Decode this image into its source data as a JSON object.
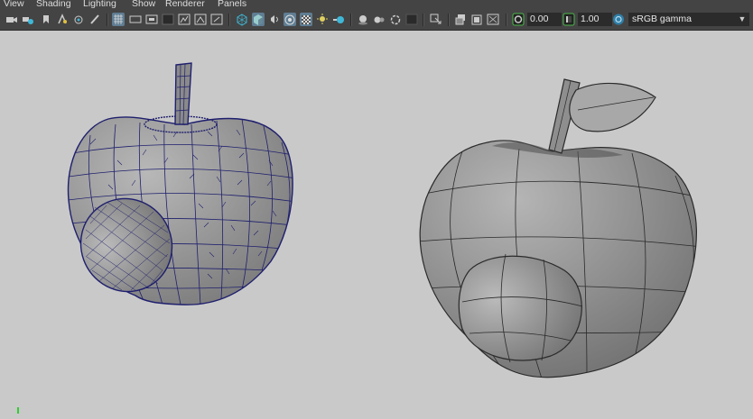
{
  "menu": {
    "view": "View",
    "shading": "Shading",
    "lighting": "Lighting",
    "show": "Show",
    "renderer": "Renderer",
    "panels": "Panels"
  },
  "toolbar": {
    "exposure": "0.00",
    "gamma": "1.00",
    "color_space": "sRGB gamma"
  },
  "colors": {
    "bg": "#c9c9c9",
    "toolbar": "#444444",
    "wire": "#1f1f6e",
    "active_toggle": "#5f7d93"
  },
  "icons": [
    "camera-icon",
    "select-camera-icon",
    "bookmark-icon",
    "camera-attributes-icon",
    "image-plane-icon",
    "film-gate-icon",
    "resolution-gate-icon",
    "gate-mask-icon",
    "field-chart-icon",
    "safe-action-icon",
    "safe-title-icon",
    "wireframe-icon",
    "smooth-shade-icon",
    "default-lighting-icon",
    "textured-icon",
    "lights-icon",
    "shadows-icon",
    "ambient-occlusion-icon",
    "motion-blur-icon",
    "anti-aliasing-icon",
    "depth-of-field-icon",
    "isolate-select-icon",
    "xray-icon",
    "xray-joints-icon",
    "xray-component-icon",
    "exposure-icon",
    "gamma-icon",
    "color-management-icon"
  ]
}
